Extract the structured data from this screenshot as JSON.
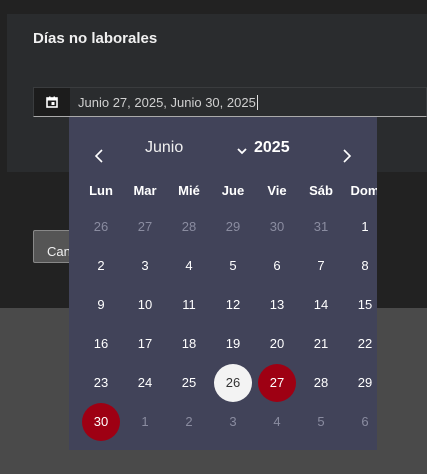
{
  "dialog": {
    "title": "Días no laborales",
    "date_field": {
      "icon": "calendar-icon",
      "value": "Junio 27, 2025, Junio 30, 2025"
    },
    "cancel_label": "Can"
  },
  "calendar": {
    "month": "Junio",
    "year": "2025",
    "weekdays": [
      "Lun",
      "Mar",
      "Mié",
      "Jue",
      "Vie",
      "Sáb",
      "Dom"
    ],
    "weeks": [
      [
        {
          "d": "26",
          "m": true
        },
        {
          "d": "27",
          "m": true
        },
        {
          "d": "28",
          "m": true
        },
        {
          "d": "29",
          "m": true
        },
        {
          "d": "30",
          "m": true
        },
        {
          "d": "31",
          "m": true
        },
        {
          "d": "1"
        }
      ],
      [
        {
          "d": "2"
        },
        {
          "d": "3"
        },
        {
          "d": "4"
        },
        {
          "d": "5"
        },
        {
          "d": "6"
        },
        {
          "d": "7"
        },
        {
          "d": "8"
        }
      ],
      [
        {
          "d": "9"
        },
        {
          "d": "10"
        },
        {
          "d": "11"
        },
        {
          "d": "12"
        },
        {
          "d": "13"
        },
        {
          "d": "14"
        },
        {
          "d": "15"
        }
      ],
      [
        {
          "d": "16"
        },
        {
          "d": "17"
        },
        {
          "d": "18"
        },
        {
          "d": "19"
        },
        {
          "d": "20"
        },
        {
          "d": "21"
        },
        {
          "d": "22"
        }
      ],
      [
        {
          "d": "23"
        },
        {
          "d": "24"
        },
        {
          "d": "25"
        },
        {
          "d": "26",
          "today": true
        },
        {
          "d": "27",
          "selected": true
        },
        {
          "d": "28"
        },
        {
          "d": "29"
        }
      ],
      [
        {
          "d": "30",
          "selected": true
        },
        {
          "d": "1",
          "m": true
        },
        {
          "d": "2",
          "m": true
        },
        {
          "d": "3",
          "m": true
        },
        {
          "d": "4",
          "m": true
        },
        {
          "d": "5",
          "m": true
        },
        {
          "d": "6",
          "m": true
        }
      ]
    ],
    "colors": {
      "background": "#414359",
      "selected": "#9e0013",
      "today": "#f3f3f3",
      "muted_text": "#8a8ca0"
    }
  }
}
